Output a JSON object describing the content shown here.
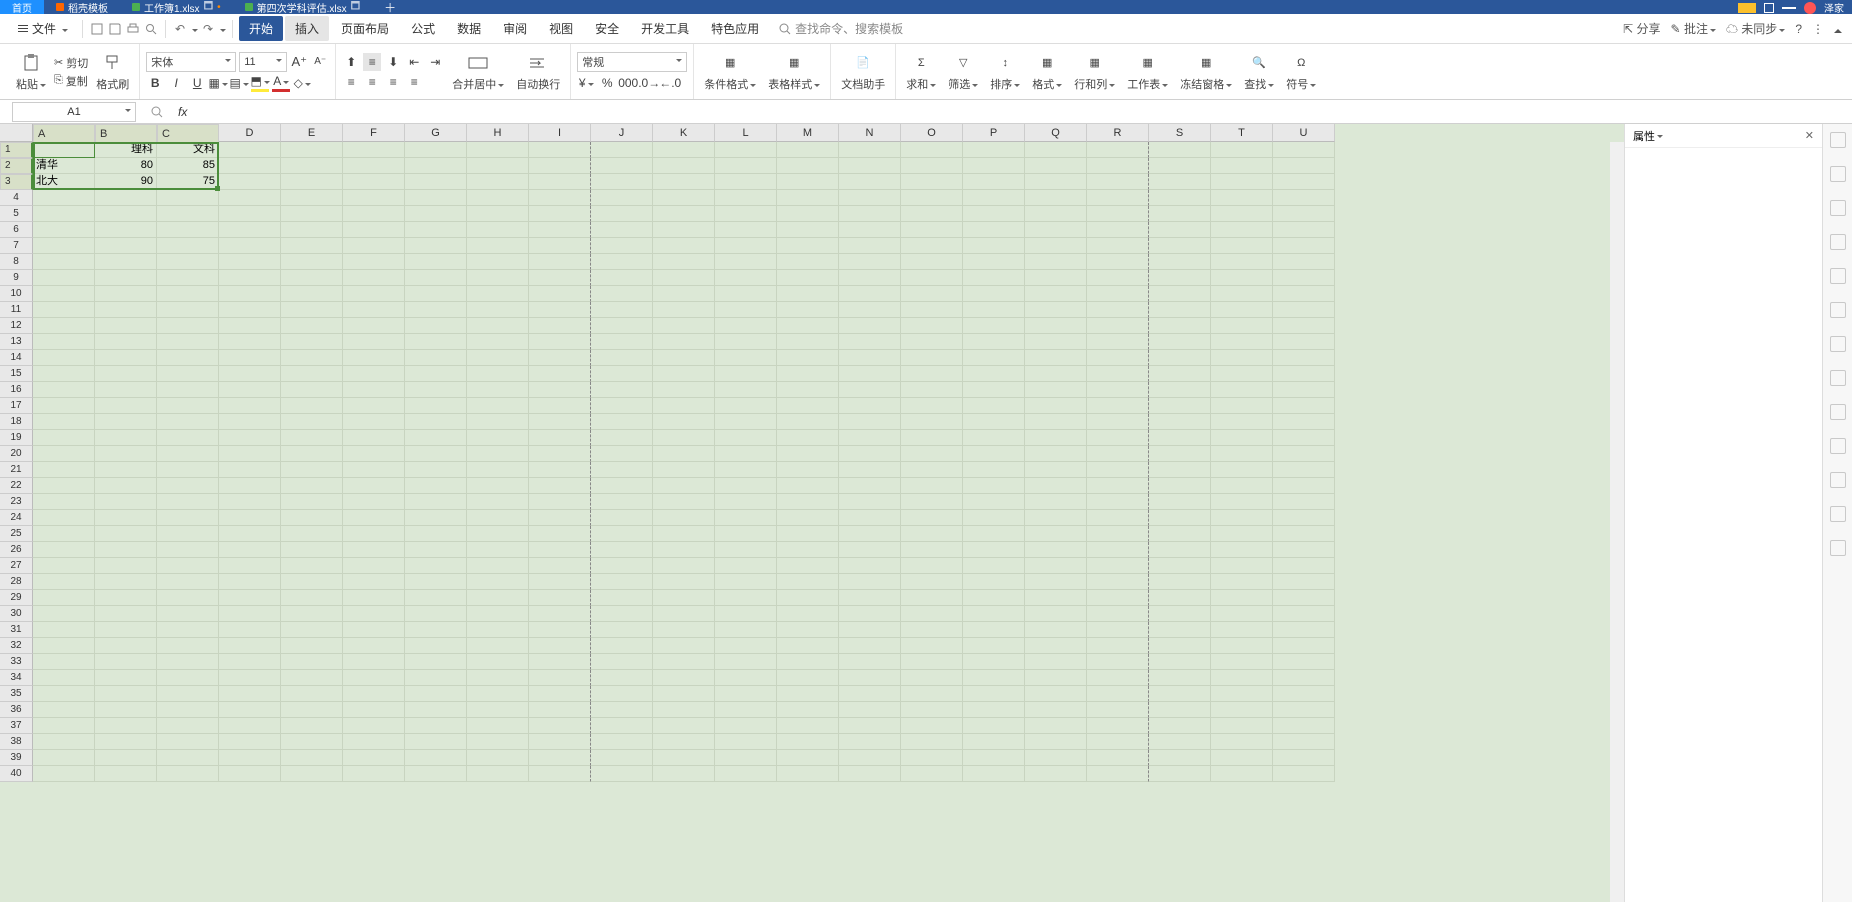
{
  "tabs": {
    "home": "首页",
    "t1": "稻壳模板",
    "t2": "工作簿1.xlsx",
    "t3": "第四次学科评估.xlsx",
    "user": "泽家"
  },
  "menu": {
    "file": "文件",
    "items": [
      "开始",
      "插入",
      "页面布局",
      "公式",
      "数据",
      "审阅",
      "视图",
      "安全",
      "开发工具",
      "特色应用"
    ],
    "search_ph": "查找命令、搜索模板",
    "share": "分享",
    "annotate": "批注",
    "sync": "未同步"
  },
  "ribbon": {
    "paste": "粘贴",
    "cut": "剪切",
    "copy": "复制",
    "fmt_painter": "格式刷",
    "font": "宋体",
    "size": "11",
    "merge": "合并居中",
    "wrap": "自动换行",
    "numfmt": "常规",
    "cond": "条件格式",
    "style": "表格样式",
    "doc_help": "文档助手",
    "sum": "求和",
    "filter": "筛选",
    "sort": "排序",
    "fmt": "格式",
    "rowcol": "行和列",
    "sheet": "工作表",
    "freeze": "冻结窗格",
    "find": "查找",
    "symbol": "符号"
  },
  "fx": {
    "name": "A1"
  },
  "cols": [
    "A",
    "B",
    "C",
    "D",
    "E",
    "F",
    "G",
    "H",
    "I",
    "J",
    "K",
    "L",
    "M",
    "N",
    "O",
    "P",
    "Q",
    "R",
    "S",
    "T",
    "U"
  ],
  "data": {
    "r1": {
      "b": "理科",
      "c": "文科"
    },
    "r2": {
      "a": "清华",
      "b": "80",
      "c": "85"
    },
    "r3": {
      "a": "北大",
      "b": "90",
      "c": "75"
    }
  },
  "panel": {
    "title": "属性"
  }
}
